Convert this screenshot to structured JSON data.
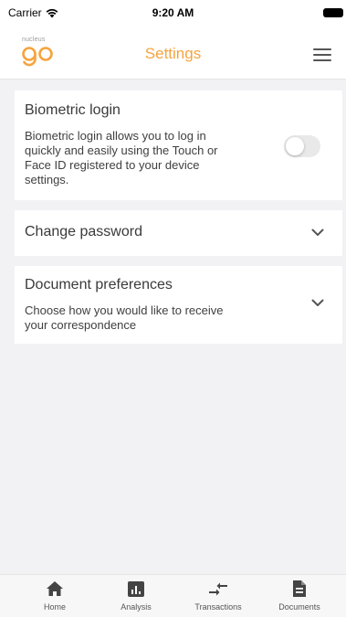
{
  "status_bar": {
    "carrier": "Carrier",
    "time": "9:20 AM"
  },
  "header": {
    "logo_small_text": "nucleus",
    "logo_text": "go",
    "title": "Settings",
    "menu_icon": "hamburger-menu-icon"
  },
  "biometric": {
    "title": "Biometric login",
    "description_lines": [
      "Biometric login allows you to log in",
      "quickly and easily using the Touch or",
      "Face ID registered to your device",
      "settings."
    ],
    "enabled": false
  },
  "change_password": {
    "title": "Change password"
  },
  "document_preferences": {
    "title": "Document preferences",
    "description_lines": [
      "Choose how you would like to receive",
      "your correspondence"
    ]
  },
  "tabs": [
    {
      "label": "Home",
      "icon": "home-icon"
    },
    {
      "label": "Analysis",
      "icon": "analysis-chart-icon"
    },
    {
      "label": "Transactions",
      "icon": "transactions-arrows-icon"
    },
    {
      "label": "Documents",
      "icon": "document-icon"
    }
  ],
  "colors": {
    "accent": "#f5a43f",
    "background": "#f2f2f4",
    "card": "#ffffff",
    "text": "#3a3a3a"
  }
}
